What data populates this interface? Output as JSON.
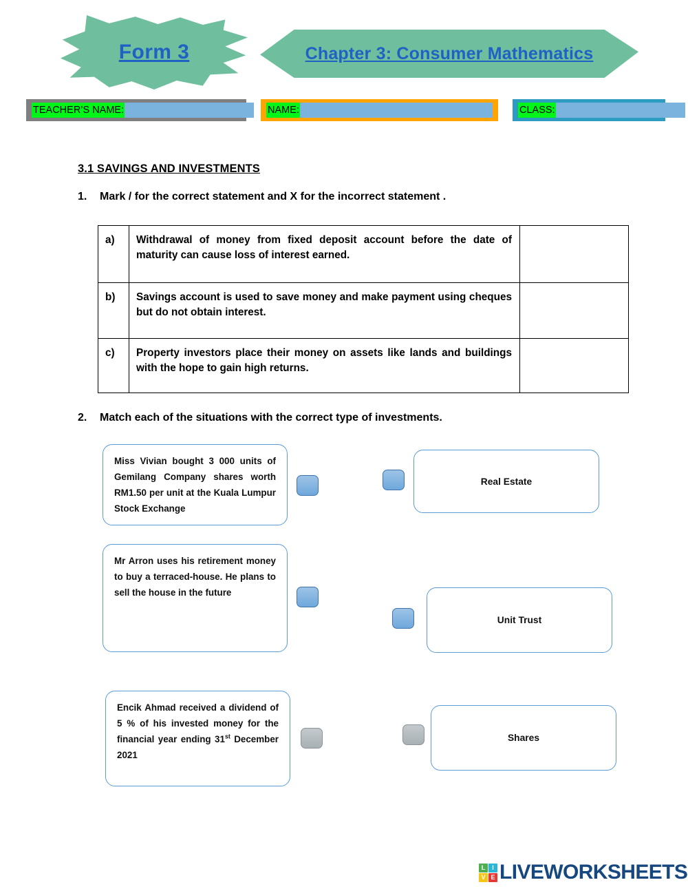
{
  "header": {
    "form_label": "Form 3",
    "chapter_label": "Chapter 3: Consumer Mathematics",
    "banner_color": "#6fbf9e",
    "banner_text_color": "#1f62c4"
  },
  "identity_fields": {
    "teacher": {
      "label": "TEACHER’S NAME:",
      "value": "",
      "placeholder": "",
      "border_color": "#7f7f7f"
    },
    "name": {
      "label": "NAME:",
      "value": "",
      "placeholder": "",
      "border_color": "#ffa400"
    },
    "class": {
      "label": "CLASS:",
      "value": "",
      "placeholder": "",
      "border_color": "#2e9bc0"
    },
    "label_highlight_color": "#00f519",
    "input_color": "#7ab3dd"
  },
  "section": {
    "title": "3.1 SAVINGS AND INVESTMENTS"
  },
  "question1": {
    "number": "1.",
    "prompt": "Mark / for the correct statement and X for the incorrect statement .",
    "rows": [
      {
        "marker": "a)",
        "statement": "Withdrawal of money from fixed deposit account before the date of maturity can cause loss of interest earned.",
        "answer": ""
      },
      {
        "marker": "b)",
        "statement": "Savings account is used to save money and make payment using cheques but do not obtain interest.",
        "answer": ""
      },
      {
        "marker": "c)",
        "statement": "Property investors place their money on assets like lands and buildings with the hope to gain high returns.",
        "answer": ""
      }
    ]
  },
  "question2": {
    "number": "2.",
    "prompt": "Match each of the situations with the correct type of investments.",
    "situations": [
      {
        "text": "Miss Vivian bought 3 000 units of Gemilang Company shares worth RM1.50 per unit at the Kuala Lumpur Stock Exchange",
        "connector_state": "blue"
      },
      {
        "text": "Mr Arron uses his retirement money to buy a terraced-house. He plans to sell the house in the future",
        "connector_state": "blue"
      },
      {
        "text_before_sup": "Encik Ahmad received a dividend of 5 % of his invested money for the financial year ending 31",
        "sup": "st",
        "text_after_sup": " December 2021",
        "connector_state": "gray"
      }
    ],
    "investment_types": [
      {
        "label": "Real Estate",
        "connector_state": "blue"
      },
      {
        "label": "Unit Trust",
        "connector_state": "blue"
      },
      {
        "label": "Shares",
        "connector_state": "gray"
      }
    ]
  },
  "footer": {
    "logo_tiles": [
      "L",
      "I",
      "V",
      "E"
    ],
    "wordmark": "LIVEWORKSHEETS",
    "wordmark_color": "#16477f"
  }
}
